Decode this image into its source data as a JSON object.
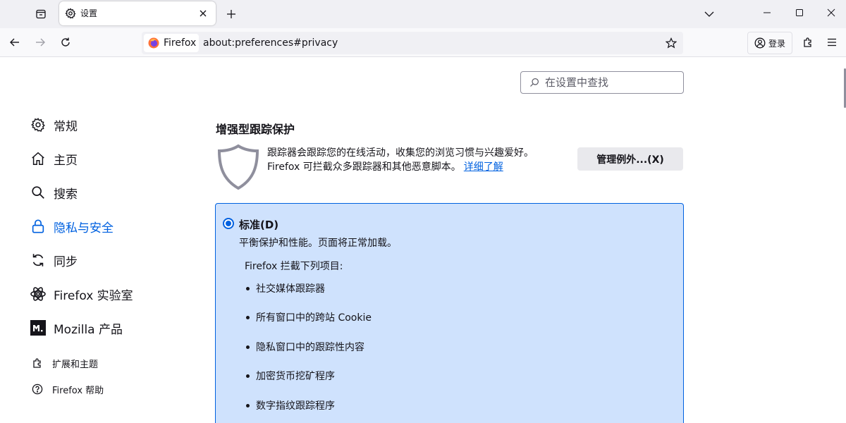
{
  "tab": {
    "title": "设置",
    "icon": "gear-icon"
  },
  "urlbar": {
    "identity_label": "Firefox",
    "url": "about:preferences#privacy"
  },
  "toolbar": {
    "signin_label": "登录"
  },
  "search": {
    "placeholder": "在设置中查找"
  },
  "categories": [
    {
      "label": "常规",
      "icon": "gear-icon"
    },
    {
      "label": "主页",
      "icon": "home-icon"
    },
    {
      "label": "搜索",
      "icon": "search-icon"
    },
    {
      "label": "隐私与安全",
      "icon": "lock-icon",
      "selected": true
    },
    {
      "label": "同步",
      "icon": "sync-icon"
    },
    {
      "label": "Firefox 实验室",
      "icon": "flask-icon"
    },
    {
      "label": "Mozilla 产品",
      "icon": "mozilla-icon"
    }
  ],
  "footer_links": [
    {
      "label": "扩展和主题",
      "icon": "puzzle-icon"
    },
    {
      "label": "Firefox 帮助",
      "icon": "help-icon"
    }
  ],
  "tracking": {
    "title": "增强型跟踪保护",
    "desc_line1": "跟踪器会跟踪您的在线活动，收集您的浏览习惯与兴趣爱好。",
    "desc_line2": "Firefox 可拦截众多跟踪器和其他恶意脚本。",
    "learn_more": "详细了解",
    "manage_exceptions": "管理例外...(X)",
    "standard": {
      "label": "标准(D)",
      "description": "平衡保护和性能。页面将正常加载。",
      "blocks_heading": "Firefox 拦截下列项目:",
      "items": [
        "社交媒体跟踪器",
        "所有窗口中的跨站 Cookie",
        "隐私窗口中的跟踪性内容",
        "加密货币挖矿程序",
        "数字指纹跟踪程序"
      ]
    }
  }
}
